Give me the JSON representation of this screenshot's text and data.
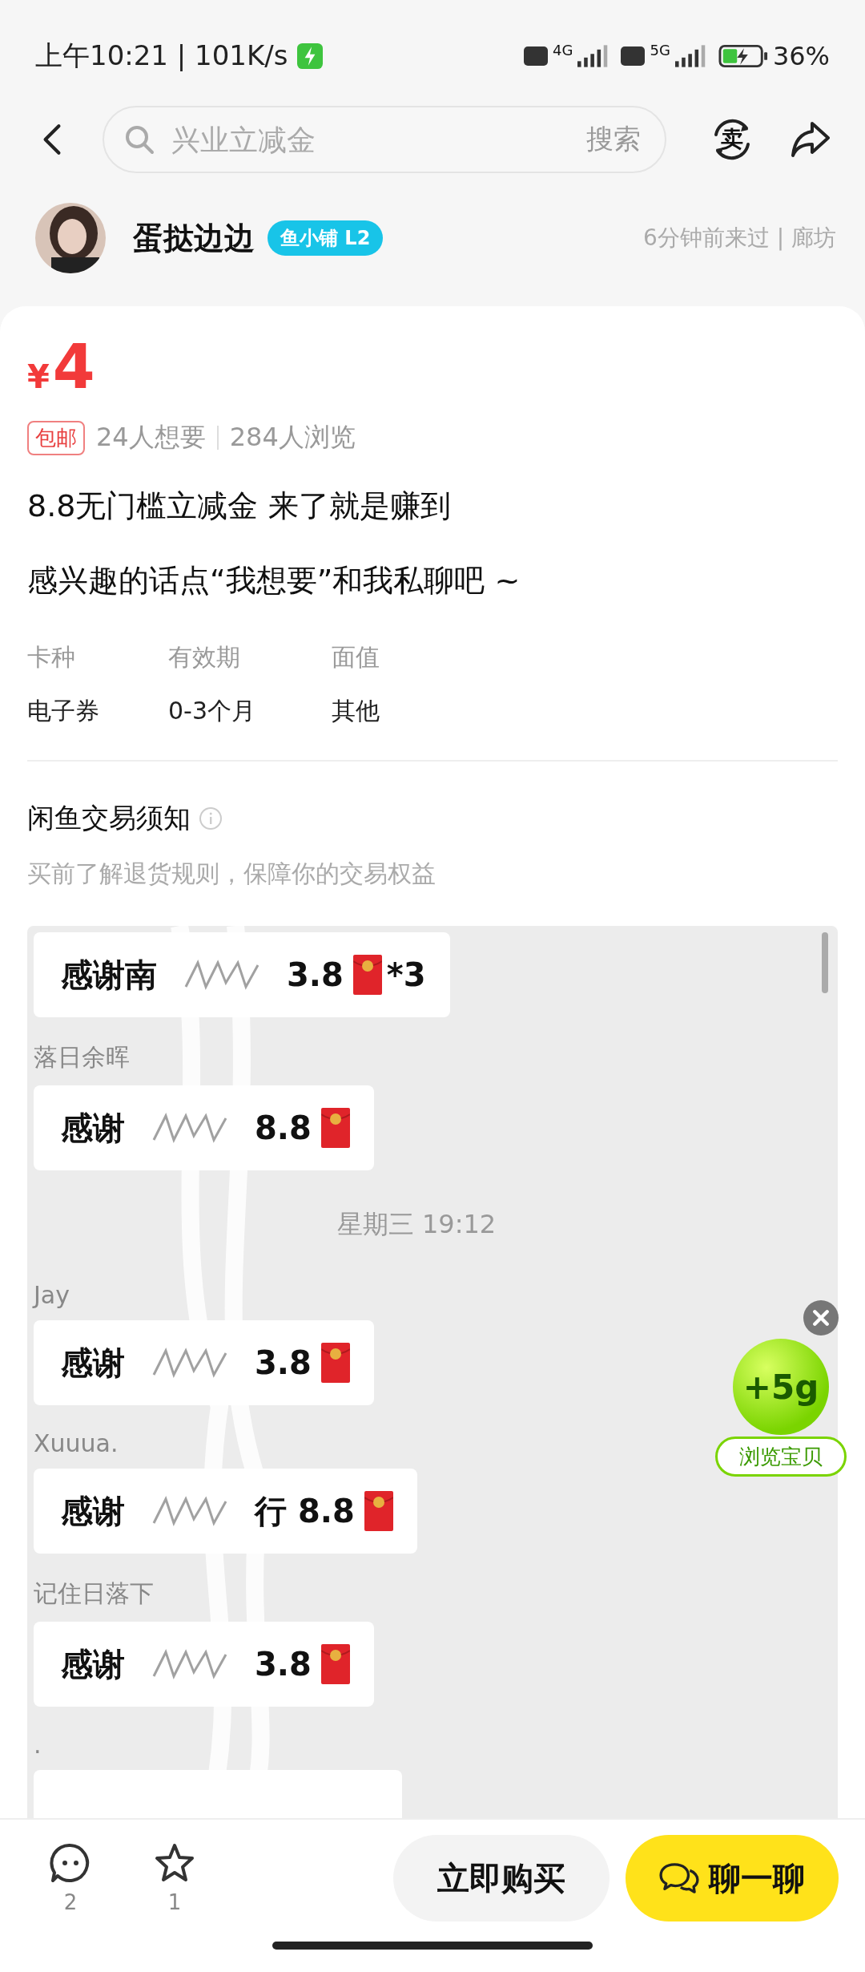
{
  "status_bar": {
    "time": "上午10:21 | 101K/s",
    "network_1": "4G",
    "network_2": "5G",
    "battery": "36%"
  },
  "header": {
    "search": {
      "placeholder": "兴业立减金"
    },
    "search_button": "搜索",
    "sell_label": "卖"
  },
  "seller": {
    "name": "蛋挞边边",
    "badge": "鱼小铺 L2",
    "visit": "6分钟前来过 | 廊坊"
  },
  "item": {
    "currency": "¥",
    "price": "4",
    "shipping_tag": "包邮",
    "wants": "24人想要",
    "views": "284人浏览",
    "title": "8.8无门槛立减金 来了就是赚到",
    "description": "感兴趣的话点“我想要”和我私聊吧 ~",
    "specs": [
      {
        "label": "卡种",
        "value": "电子券"
      },
      {
        "label": "有效期",
        "value": "0-3个月"
      },
      {
        "label": "面值",
        "value": "其他"
      }
    ]
  },
  "notice": {
    "title": "闲鱼交易须知",
    "subtitle": "买前了解退货规则，保障你的交易权益"
  },
  "chat_image": {
    "messages": [
      {
        "kind": "bubble",
        "before": "感谢南",
        "after": "3.8",
        "extra": "*3"
      },
      {
        "kind": "sender",
        "text": "落日余晖"
      },
      {
        "kind": "bubble",
        "before": "感谢",
        "after": "8.8"
      },
      {
        "kind": "time",
        "text": "星期三 19:12"
      },
      {
        "kind": "sender",
        "text": "Jay"
      },
      {
        "kind": "bubble",
        "before": "感谢",
        "after": "3.8"
      },
      {
        "kind": "sender",
        "text": "Xuuua."
      },
      {
        "kind": "bubble",
        "before": "感谢",
        "after": "行 8.8"
      },
      {
        "kind": "sender",
        "text": "记住日落下"
      },
      {
        "kind": "bubble",
        "before": "感谢",
        "after": "3.8"
      },
      {
        "kind": "sender",
        "text": "."
      },
      {
        "kind": "bubble_cut"
      }
    ]
  },
  "reward": {
    "amount": "+5g",
    "label": "浏览宝贝"
  },
  "bottom_bar": {
    "comments": "2",
    "favorites": "1",
    "buy": "立即购买",
    "chat": "聊一聊"
  }
}
